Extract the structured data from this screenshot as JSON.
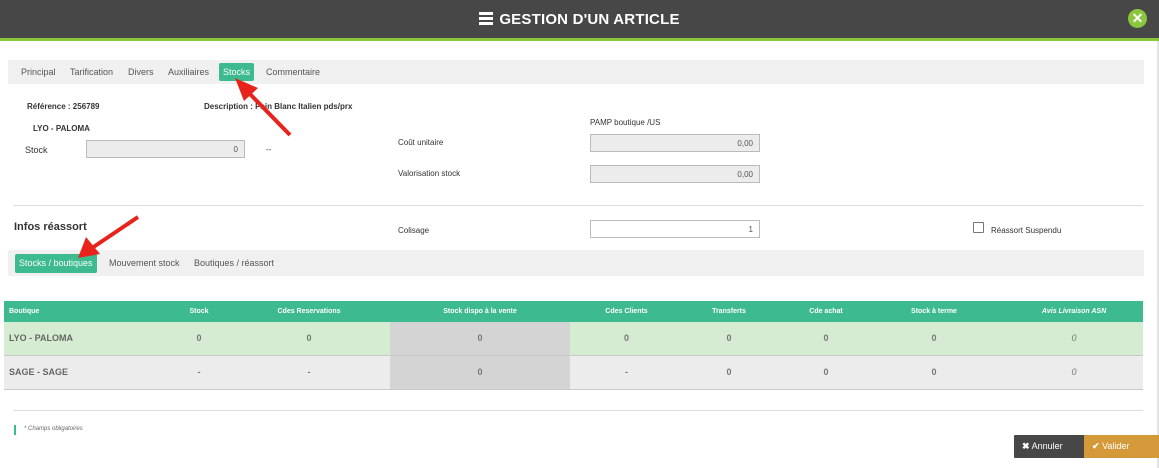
{
  "modal": {
    "title": "GESTION D'UN ARTICLE",
    "close_icon": "close-icon",
    "title_icon": "server-icon"
  },
  "tabs": [
    {
      "label": "Principal"
    },
    {
      "label": "Tarification"
    },
    {
      "label": "Divers"
    },
    {
      "label": "Auxiliaires"
    },
    {
      "label": "Stocks",
      "active": true
    },
    {
      "label": "Commentaire"
    }
  ],
  "article": {
    "reference_label": "Référence : 256789",
    "description_label": "Description : Pain Blanc Italien pds/prx",
    "store_label": "LYO - PALOMA",
    "stock_label": "Stock",
    "stock_value": "0",
    "stock_suffix": "--",
    "pamp_label": "PAMP boutique /US",
    "cout_label": "Coût unitaire",
    "cout_value": "0,00",
    "valorisation_label": "Valorisation stock",
    "valorisation_value": "0,00"
  },
  "reassort": {
    "title": "Infos réassort",
    "colisage_label": "Colisage",
    "colisage_value": "1",
    "suspendu_label": "Réassort Suspendu",
    "suspendu_checked": false
  },
  "subtabs": [
    {
      "label": "Stocks / boutiques",
      "active": true
    },
    {
      "label": "Mouvement stock"
    },
    {
      "label": "Boutiques / réassort"
    }
  ],
  "table": {
    "headers": [
      "Boutique",
      "Stock",
      "Cdes Reservations",
      "Stock dispo à la vente",
      "Cdes Clients",
      "Transferts",
      "Cde achat",
      "Stock à terme",
      "Avis Livraison ASN"
    ],
    "rows": [
      [
        "LYO - PALOMA",
        "0",
        "0",
        "0",
        "0",
        "0",
        "0",
        "0",
        "0"
      ],
      [
        "SAGE - SAGE",
        "-",
        "-",
        "0",
        "-",
        "0",
        "0",
        "0",
        "0"
      ]
    ]
  },
  "footer": {
    "required_note": "* Champs obligatoires",
    "cancel_label": "Annuler",
    "validate_label": "Valider"
  },
  "colors": {
    "header_bg": "#474747",
    "accent_green": "#8cc63f",
    "teal": "#3dba8f",
    "cancel_bg": "#474747",
    "validate_bg": "#d49a3a",
    "arrow": "#e8231c"
  }
}
